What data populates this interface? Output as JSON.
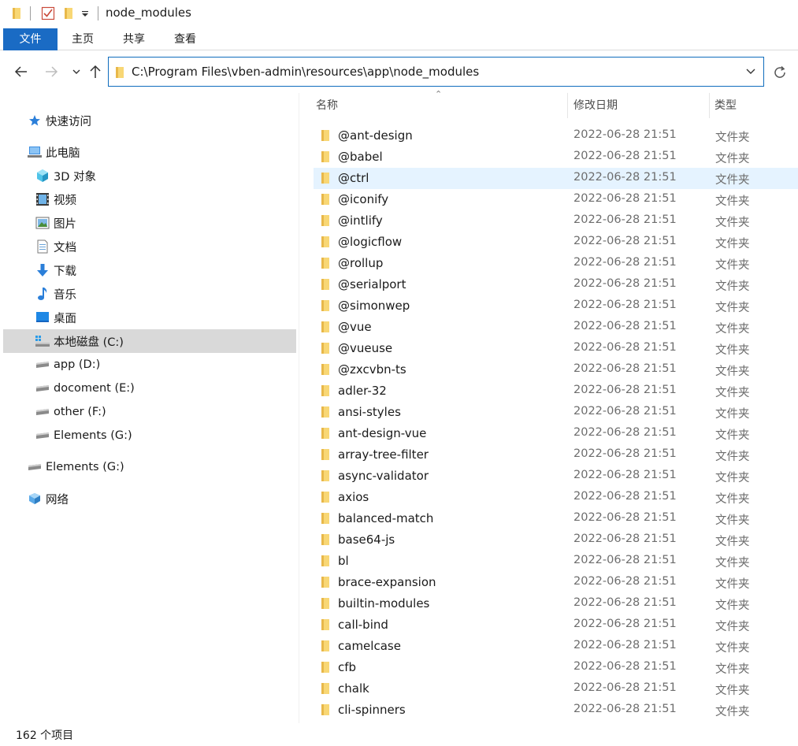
{
  "window": {
    "title": "node_modules"
  },
  "ribbon": {
    "tabs": [
      {
        "label": "文件"
      },
      {
        "label": "主页"
      },
      {
        "label": "共享"
      },
      {
        "label": "查看"
      }
    ]
  },
  "address_bar": {
    "path": "C:\\Program Files\\vben-admin\\resources\\app\\node_modules"
  },
  "sidebar": {
    "items": [
      {
        "label": "快速访问",
        "icon": "star-icon"
      },
      {
        "label": "此电脑",
        "icon": "computer-icon"
      },
      {
        "label": "3D 对象",
        "icon": "3d-objects-icon"
      },
      {
        "label": "视频",
        "icon": "video-icon"
      },
      {
        "label": "图片",
        "icon": "pictures-icon"
      },
      {
        "label": "文档",
        "icon": "documents-icon"
      },
      {
        "label": "下载",
        "icon": "download-icon"
      },
      {
        "label": "音乐",
        "icon": "music-icon"
      },
      {
        "label": "桌面",
        "icon": "desktop-icon"
      },
      {
        "label": "本地磁盘 (C:)",
        "icon": "local-disk-icon"
      },
      {
        "label": "app (D:)",
        "icon": "drive-icon"
      },
      {
        "label": "docoment (E:)",
        "icon": "drive-icon"
      },
      {
        "label": "other (F:)",
        "icon": "drive-icon"
      },
      {
        "label": "Elements (G:)",
        "icon": "drive-icon"
      },
      {
        "label": "Elements (G:)",
        "icon": "drive-icon"
      },
      {
        "label": "网络",
        "icon": "network-icon"
      }
    ]
  },
  "columns": {
    "name": "名称",
    "date": "修改日期",
    "type": "类型"
  },
  "files": [
    {
      "name": "@ant-design",
      "date": "2022-06-28 21:51",
      "type": "文件夹"
    },
    {
      "name": "@babel",
      "date": "2022-06-28 21:51",
      "type": "文件夹"
    },
    {
      "name": "@ctrl",
      "date": "2022-06-28 21:51",
      "type": "文件夹"
    },
    {
      "name": "@iconify",
      "date": "2022-06-28 21:51",
      "type": "文件夹"
    },
    {
      "name": "@intlify",
      "date": "2022-06-28 21:51",
      "type": "文件夹"
    },
    {
      "name": "@logicflow",
      "date": "2022-06-28 21:51",
      "type": "文件夹"
    },
    {
      "name": "@rollup",
      "date": "2022-06-28 21:51",
      "type": "文件夹"
    },
    {
      "name": "@serialport",
      "date": "2022-06-28 21:51",
      "type": "文件夹"
    },
    {
      "name": "@simonwep",
      "date": "2022-06-28 21:51",
      "type": "文件夹"
    },
    {
      "name": "@vue",
      "date": "2022-06-28 21:51",
      "type": "文件夹"
    },
    {
      "name": "@vueuse",
      "date": "2022-06-28 21:51",
      "type": "文件夹"
    },
    {
      "name": "@zxcvbn-ts",
      "date": "2022-06-28 21:51",
      "type": "文件夹"
    },
    {
      "name": "adler-32",
      "date": "2022-06-28 21:51",
      "type": "文件夹"
    },
    {
      "name": "ansi-styles",
      "date": "2022-06-28 21:51",
      "type": "文件夹"
    },
    {
      "name": "ant-design-vue",
      "date": "2022-06-28 21:51",
      "type": "文件夹"
    },
    {
      "name": "array-tree-filter",
      "date": "2022-06-28 21:51",
      "type": "文件夹"
    },
    {
      "name": "async-validator",
      "date": "2022-06-28 21:51",
      "type": "文件夹"
    },
    {
      "name": "axios",
      "date": "2022-06-28 21:51",
      "type": "文件夹"
    },
    {
      "name": "balanced-match",
      "date": "2022-06-28 21:51",
      "type": "文件夹"
    },
    {
      "name": "base64-js",
      "date": "2022-06-28 21:51",
      "type": "文件夹"
    },
    {
      "name": "bl",
      "date": "2022-06-28 21:51",
      "type": "文件夹"
    },
    {
      "name": "brace-expansion",
      "date": "2022-06-28 21:51",
      "type": "文件夹"
    },
    {
      "name": "builtin-modules",
      "date": "2022-06-28 21:51",
      "type": "文件夹"
    },
    {
      "name": "call-bind",
      "date": "2022-06-28 21:51",
      "type": "文件夹"
    },
    {
      "name": "camelcase",
      "date": "2022-06-28 21:51",
      "type": "文件夹"
    },
    {
      "name": "cfb",
      "date": "2022-06-28 21:51",
      "type": "文件夹"
    },
    {
      "name": "chalk",
      "date": "2022-06-28 21:51",
      "type": "文件夹"
    },
    {
      "name": "cli-spinners",
      "date": "2022-06-28 21:51",
      "type": "文件夹"
    }
  ],
  "status": {
    "item_count": "162 个项目"
  },
  "colors": {
    "accent": "#1a6bc4",
    "folder": "#f8d775",
    "hover_row": "#e5f3ff",
    "selected_nav": "#d9d9d9"
  }
}
